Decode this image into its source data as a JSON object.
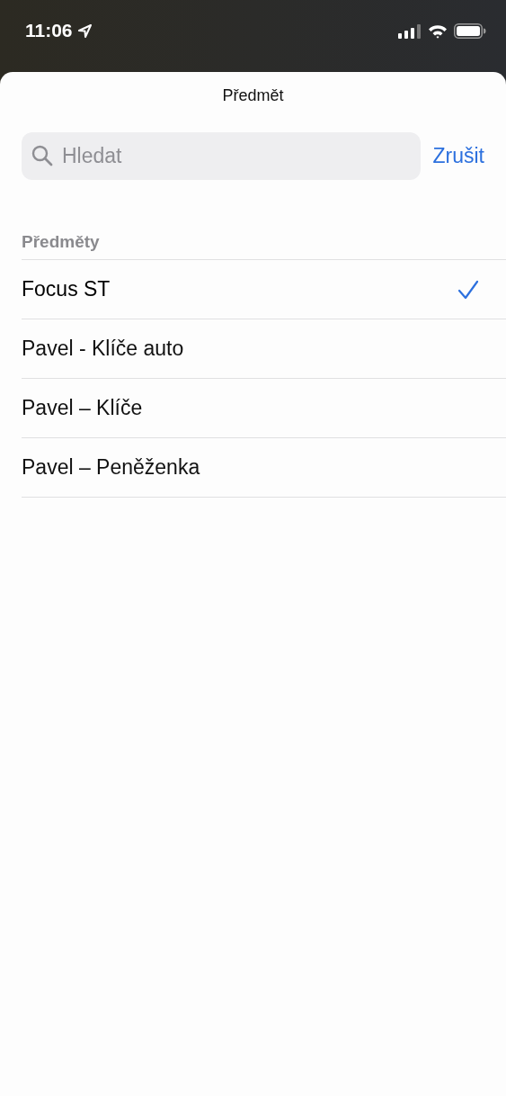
{
  "status_bar": {
    "time": "11:06"
  },
  "sheet": {
    "title": "Předmět"
  },
  "search": {
    "placeholder": "Hledat",
    "cancel": "Zrušit"
  },
  "section": {
    "header": "Předměty",
    "items": [
      {
        "label": "Focus ST",
        "selected": true
      },
      {
        "label": "Pavel - Klíče auto",
        "selected": false
      },
      {
        "label": "Pavel – Klíče",
        "selected": false
      },
      {
        "label": "Pavel – Peněženka",
        "selected": false
      }
    ]
  }
}
